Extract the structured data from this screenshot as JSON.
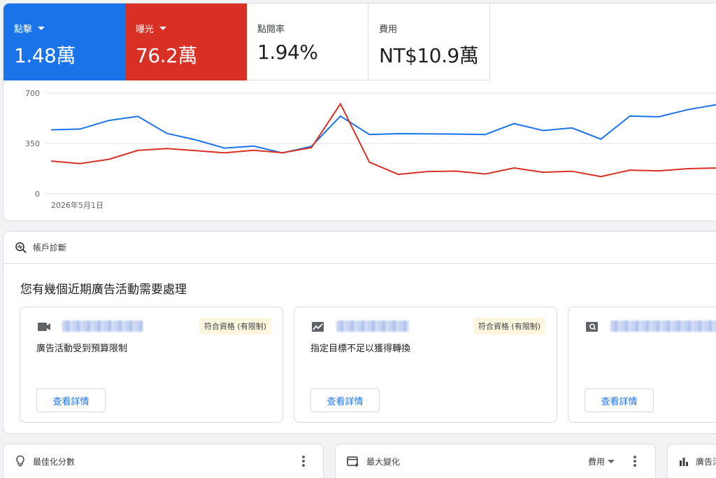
{
  "metrics": [
    {
      "label": "點擊",
      "value": "1.48萬",
      "dropdown": true,
      "color": "#1a73e8"
    },
    {
      "label": "曝光",
      "value": "76.2萬",
      "dropdown": true,
      "color": "#d93025"
    },
    {
      "label": "點閱率",
      "value": "1.94%",
      "dropdown": false
    },
    {
      "label": "費用",
      "value": "NT$10.9萬",
      "dropdown": false
    }
  ],
  "chart_data": {
    "type": "line",
    "ylim": [
      0,
      700
    ],
    "yticks": [
      "700",
      "350",
      "0"
    ],
    "x_start_label": "2026年5月1日",
    "grid": true,
    "series": [
      {
        "color": "#1a73e8",
        "values": [
          445,
          450,
          510,
          538,
          420,
          375,
          318,
          332,
          284,
          330,
          540,
          412,
          418,
          417,
          415,
          412,
          488,
          440,
          458,
          380,
          540,
          535,
          585,
          620
        ]
      },
      {
        "color": "#d93025",
        "values": [
          228,
          210,
          240,
          302,
          315,
          300,
          285,
          303,
          286,
          322,
          625,
          220,
          135,
          155,
          158,
          138,
          180,
          150,
          157,
          120,
          165,
          160,
          175,
          180
        ]
      }
    ]
  },
  "diagnostics": {
    "header": "帳戶診斷",
    "title": "您有幾個近期廣告活動需要處理",
    "cards": [
      {
        "icon": "video-camera-icon",
        "badge": "符合資格 (有限制)",
        "description": "廣告活動受到預算限制",
        "button": "查看詳情"
      },
      {
        "icon": "trend-chart-icon",
        "badge": "符合資格 (有限制)",
        "description": "指定目標不足以獲得轉換",
        "button": "查看詳情"
      },
      {
        "icon": "search-ad-icon",
        "badge": "",
        "description": "",
        "button": "查看詳情"
      }
    ]
  },
  "bottom": {
    "optimization": "最佳化分數",
    "biggest_changes": "最大變化",
    "biggest_changes_filter": "費用",
    "third": "廣告活"
  }
}
